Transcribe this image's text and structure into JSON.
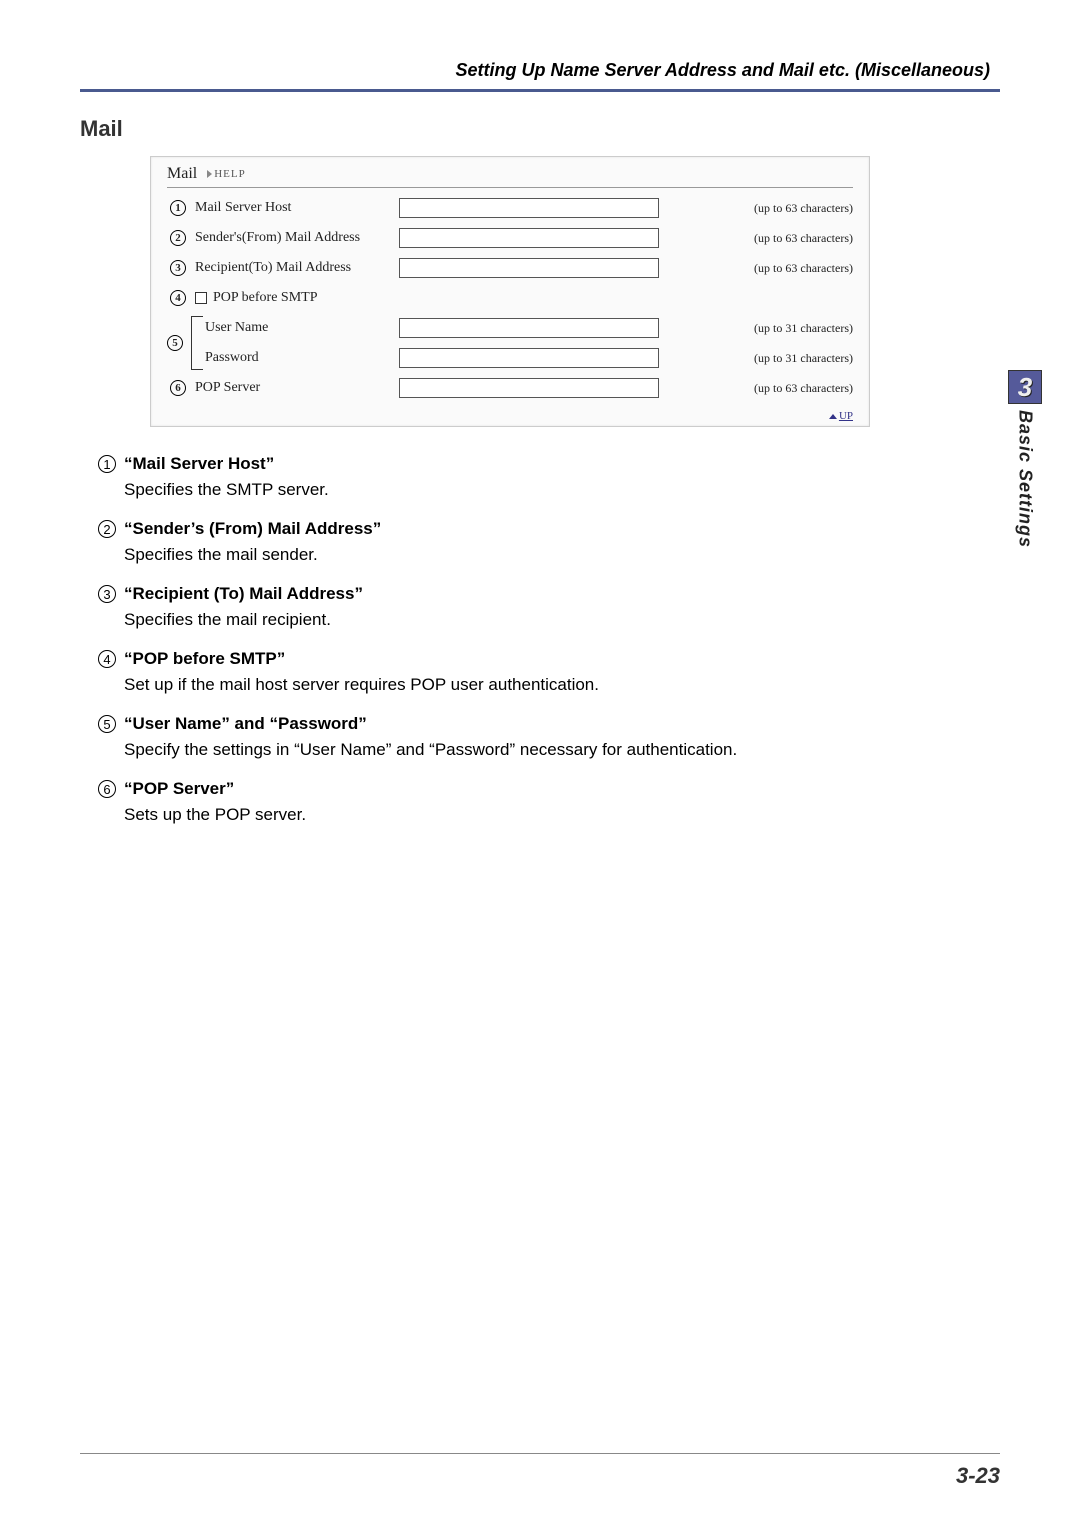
{
  "header": {
    "title": "Setting Up Name Server Address and Mail etc. (Miscellaneous)"
  },
  "section": {
    "title": "Mail"
  },
  "screenshot": {
    "title": "Mail",
    "help_label": "HELP",
    "rows": {
      "r1": {
        "num": "1",
        "label": "Mail Server Host",
        "hint": "(up to 63 characters)"
      },
      "r2": {
        "num": "2",
        "label": "Sender's(From) Mail Address",
        "hint": "(up to 63 characters)"
      },
      "r3": {
        "num": "3",
        "label": "Recipient(To) Mail Address",
        "hint": "(up to 63 characters)"
      },
      "r4": {
        "num": "4",
        "label": "POP before SMTP"
      },
      "r5": {
        "num": "5",
        "user_label": "User Name",
        "pass_label": "Password",
        "user_hint": "(up to 31 characters)",
        "pass_hint": "(up to 31 characters)"
      },
      "r6": {
        "num": "6",
        "label": "POP Server",
        "hint": "(up to 63 characters)"
      }
    },
    "up_link": "UP"
  },
  "explanations": [
    {
      "num": "1",
      "title": "“Mail Server Host”",
      "desc": "Specifies the SMTP server."
    },
    {
      "num": "2",
      "title": "“Sender’s (From) Mail Address”",
      "desc": "Specifies the mail sender."
    },
    {
      "num": "3",
      "title": "“Recipient (To) Mail Address”",
      "desc": "Specifies the mail recipient."
    },
    {
      "num": "4",
      "title": "“POP before SMTP”",
      "desc": "Set up if the mail host server requires POP user authentication."
    },
    {
      "num": "5",
      "title": "“User Name” and “Password”",
      "desc": "Specify the settings in “User Name” and “Password” necessary for authentication."
    },
    {
      "num": "6",
      "title": "“POP Server”",
      "desc": "Sets up the POP server."
    }
  ],
  "sidebar": {
    "chapter": "3",
    "label": "Basic Settings"
  },
  "footer": {
    "page": "3-23"
  }
}
